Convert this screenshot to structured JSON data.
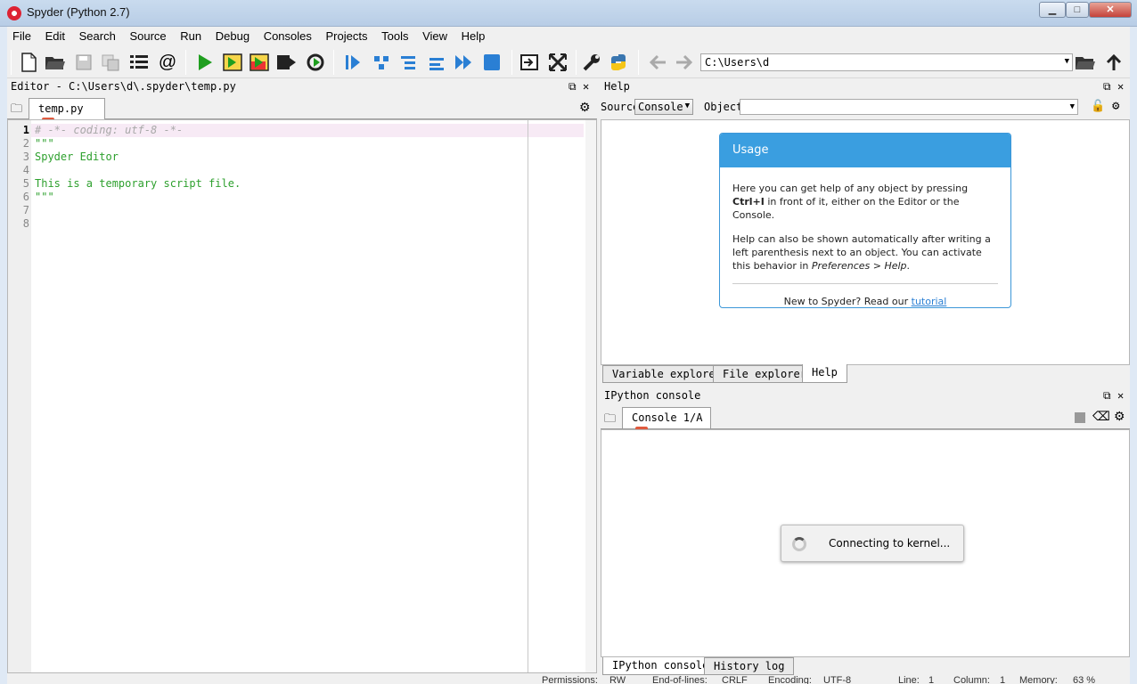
{
  "window": {
    "title": "Spyder (Python 2.7)",
    "min": "▁",
    "max": "□",
    "close": "✕"
  },
  "menu": [
    "File",
    "Edit",
    "Search",
    "Source",
    "Run",
    "Debug",
    "Consoles",
    "Projects",
    "Tools",
    "View",
    "Help"
  ],
  "toolbar": {
    "icons": [
      "new-file",
      "open-file",
      "save-file",
      "save-all",
      "outline",
      "at-sign",
      "run",
      "run-cell",
      "run-cell-advance",
      "run-selection",
      "rerun",
      "debug",
      "step",
      "step-into",
      "step-return",
      "continue",
      "stop",
      "maximize-pane",
      "fullscreen",
      "preferences",
      "python-path",
      "back",
      "forward"
    ],
    "path": "C:\\Users\\d",
    "glyph_at": "@"
  },
  "editor": {
    "title": "Editor - C:\\Users\\d\\.spyder\\temp.py",
    "tab": "temp.py",
    "lines": [
      {
        "n": "1",
        "text": "# -*- coding: utf-8 -*-"
      },
      {
        "n": "2",
        "text": "\"\"\""
      },
      {
        "n": "3",
        "text": "Spyder Editor"
      },
      {
        "n": "4",
        "text": ""
      },
      {
        "n": "5",
        "text": "This is a temporary script file."
      },
      {
        "n": "6",
        "text": "\"\"\""
      },
      {
        "n": "7",
        "text": ""
      },
      {
        "n": "8",
        "text": ""
      }
    ],
    "colors": {
      "comment": "#a8a8a8",
      "string": "#2ea02e",
      "highlight": "#f7eaf5"
    }
  },
  "help": {
    "title": "Help",
    "source_label": "Source",
    "source_value": "Console",
    "object_label": "Object",
    "card_title": "Usage",
    "p1_a": "Here you can get help of any object by pressing ",
    "p1_b": "Ctrl+I",
    "p1_c": " in front of it, either on the Editor or the Console.",
    "p2_a": "Help can also be shown automatically after writing a left parenthesis next to an object. You can activate this behavior in ",
    "p2_b": "Preferences > Help",
    "p2_c": ".",
    "footer_a": "New to Spyder? Read our ",
    "footer_link": "tutorial"
  },
  "tabs_top": [
    "Variable explorer",
    "File explorer",
    "Help"
  ],
  "console": {
    "title": "IPython console",
    "tab": "Console 1/A",
    "connecting": "Connecting to kernel..."
  },
  "tabs_bottom": [
    "IPython console",
    "History log"
  ],
  "statusbar": {
    "permissions": "Permissions:",
    "permissions_value": "RW",
    "eol": "End-of-lines:",
    "eol_value": "CRLF",
    "encoding": "Encoding:",
    "encoding_value": "UTF-8",
    "line": "Line:",
    "line_value": "1",
    "column": "Column:",
    "column_value": "1",
    "memory": "Memory:",
    "memory_value": "63 %"
  }
}
